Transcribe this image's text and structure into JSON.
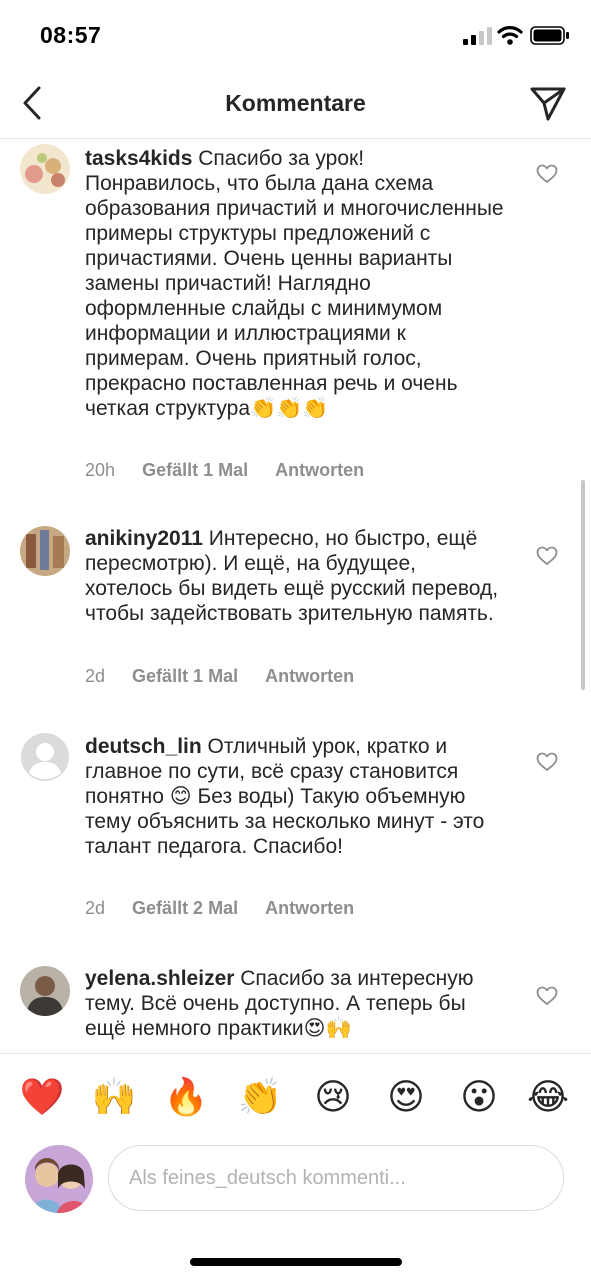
{
  "status_bar": {
    "time": "08:57"
  },
  "header": {
    "title": "Kommentare"
  },
  "comments": [
    {
      "username": "tasks4kids",
      "text": "Спасибо за урок! Понравилось, что была дана схема образования причастий и многочисленные примеры структуры предложений с  причастиями. Очень ценны варианты замены причастий! Наглядно оформленные слайды с минимумом информации и иллюстрациями к примерам. Очень приятный голос, прекрасно поставленная речь и очень четкая структура👏👏👏",
      "time": "20h",
      "likes": "Gefällt 1 Mal",
      "reply": "Antworten"
    },
    {
      "username": "anikiny2011",
      "text": "Интересно, но быстро, ещё пересмотрю). И ещё, на будущее, хотелось бы видеть ещё русский перевод, чтобы задействовать зрительную память.",
      "time": "2d",
      "likes": "Gefällt 1 Mal",
      "reply": "Antworten"
    },
    {
      "username": "deutsch_lin",
      "text": "Отличный урок, кратко и главное по сути, всё сразу становится понятно 😊 Без воды) Такую объемную тему объяснить за несколько минут - это талант педагога. Спасибо!",
      "time": "2d",
      "likes": "Gefällt 2 Mal",
      "reply": "Antworten"
    },
    {
      "username": "yelena.shleizer",
      "text": "Спасибо за интересную тему. Всё очень доступно. А теперь бы ещё немного практики😍🙌",
      "time": "",
      "likes": "",
      "reply": ""
    }
  ],
  "emoji_bar": [
    "❤️",
    "🙌",
    "🔥",
    "👏",
    "😢",
    "😍",
    "😮",
    "😂"
  ],
  "input": {
    "placeholder": "Als feines_deutsch kommenti..."
  },
  "icons": {
    "back": "chevron-left-icon",
    "send": "paper-plane-icon",
    "like": "heart-outline-icon"
  }
}
